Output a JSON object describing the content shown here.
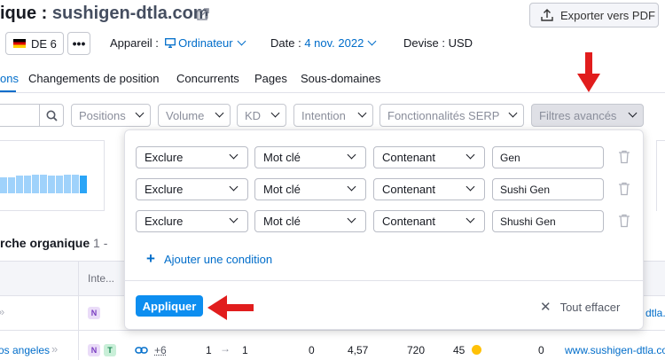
{
  "header": {
    "title_prefix": "ique : ",
    "domain": "sushigen-dtla.com",
    "export_label": "Exporter vers PDF"
  },
  "settings": {
    "database": "DE 6",
    "more": "•••",
    "device_label": "Appareil :",
    "device_value": "Ordinateur",
    "date_label": "Date :",
    "date_value": "4 nov. 2022",
    "currency": "Devise : USD"
  },
  "tabs": [
    {
      "label": "ons",
      "active": true
    },
    {
      "label": "Changements de position"
    },
    {
      "label": "Concurrents"
    },
    {
      "label": "Pages"
    },
    {
      "label": "Sous-domaines"
    }
  ],
  "filters": {
    "positions": "Positions",
    "volume": "Volume",
    "kd": "KD",
    "intention": "Intention",
    "serp": "Fonctionnalités SERP",
    "advanced": "Filtres avancés"
  },
  "advanced_filter": {
    "conditions": [
      {
        "action": "Exclure",
        "field": "Mot clé",
        "operator": "Contenant",
        "value": "Gen"
      },
      {
        "action": "Exclure",
        "field": "Mot clé",
        "operator": "Contenant",
        "value": "Sushi Gen"
      },
      {
        "action": "Exclure",
        "field": "Mot clé",
        "operator": "Contenant",
        "value": "Shushi Gen"
      }
    ],
    "add_condition": "Ajouter une condition",
    "apply": "Appliquer",
    "clear": "Tout effacer"
  },
  "table": {
    "section_title": "rche organique",
    "section_count": "1 -",
    "header_intent": "Inte...",
    "row1": {
      "keyword_arrows": "»",
      "intent": "N",
      "url": "dtla.c"
    },
    "row2": {
      "keyword": "os angeles",
      "keyword_arrows": "»",
      "intent_n": "N",
      "intent_t": "T",
      "serp_more": "+6",
      "pos_from": "1",
      "pos_to": "1",
      "diff": "0",
      "cpc": "4,57",
      "volume": "720",
      "kd": "45",
      "traffic": "0",
      "url": "www.sushigen-dtla.com"
    }
  },
  "colors": {
    "accent": "#006dca",
    "apply_button": "#0d8ef0",
    "annotation_arrow": "#e11d1d",
    "kd_dot": "#ffc107"
  }
}
